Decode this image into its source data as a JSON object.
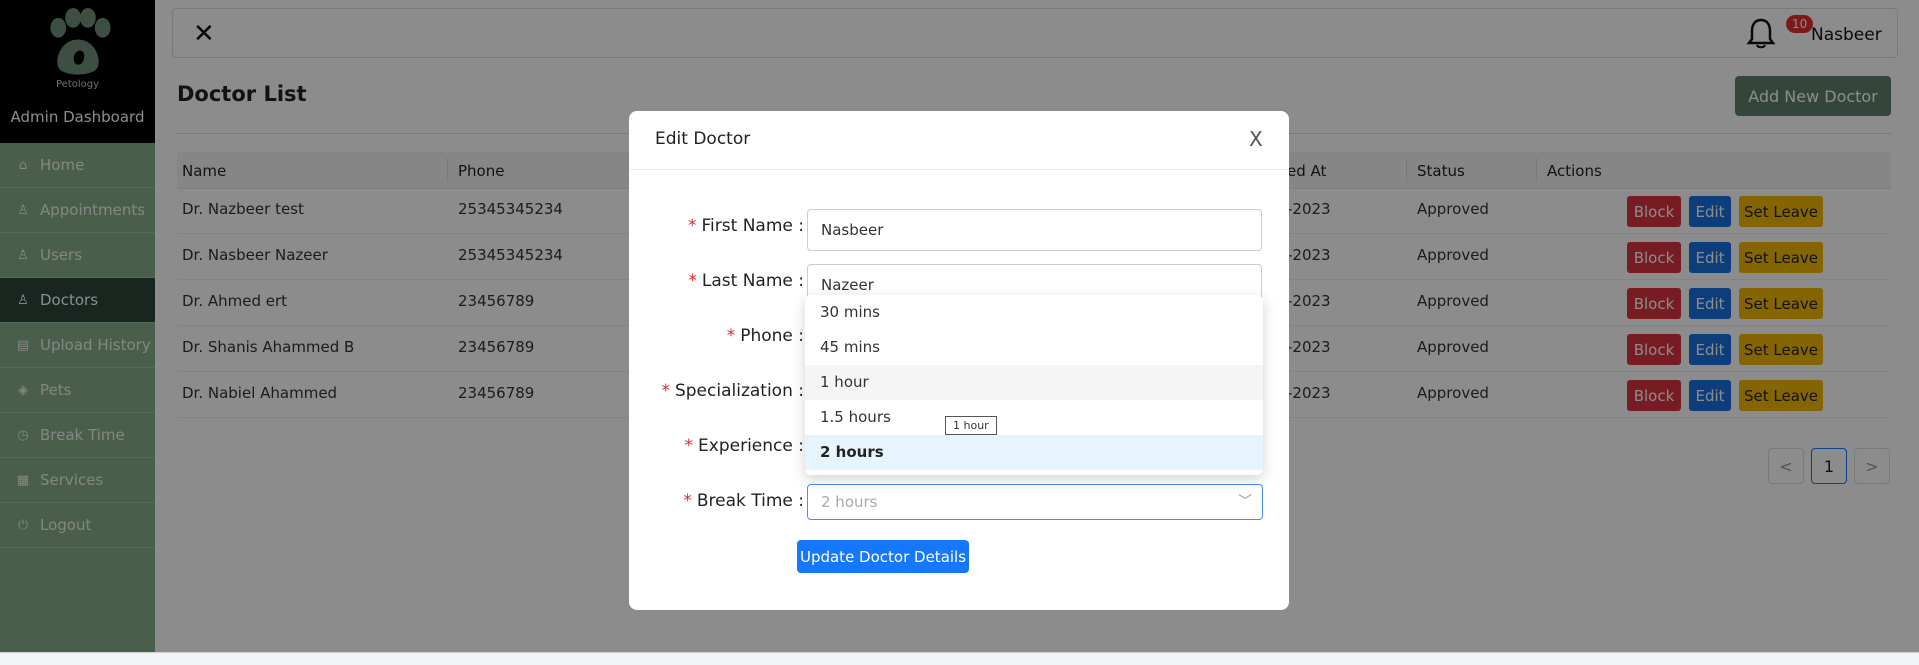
{
  "sidebar": {
    "brand": "Petology",
    "title": "Admin Dashboard",
    "items": [
      {
        "label": "Home",
        "icon": "home-icon",
        "glyph": "⌂"
      },
      {
        "label": "Appointments",
        "icon": "user-check-icon",
        "glyph": "♙"
      },
      {
        "label": "Users",
        "icon": "user-icon",
        "glyph": "♙"
      },
      {
        "label": "Doctors",
        "icon": "doctor-icon",
        "glyph": "♙"
      },
      {
        "label": "Upload History",
        "icon": "file-icon",
        "glyph": "▤"
      },
      {
        "label": "Pets",
        "icon": "shield-icon",
        "glyph": "◈"
      },
      {
        "label": "Break Time",
        "icon": "clock-icon",
        "glyph": "◷"
      },
      {
        "label": "Services",
        "icon": "list-icon",
        "glyph": "▦"
      },
      {
        "label": "Logout",
        "icon": "logout-icon",
        "glyph": "⏻"
      }
    ],
    "active_index": 3
  },
  "topbar": {
    "notification_count": "10",
    "username": "Nasbeer"
  },
  "page": {
    "title": "Doctor List",
    "add_button": "Add New Doctor"
  },
  "table": {
    "headers": [
      "Name",
      "Phone",
      "ed At",
      "Status",
      "Actions"
    ],
    "rows": [
      {
        "name": "Dr. Nazbeer test",
        "phone": "25345345234",
        "date": "-2023",
        "status": "Approved"
      },
      {
        "name": "Dr. Nasbeer Nazeer",
        "phone": "25345345234",
        "date": "-2023",
        "status": "Approved"
      },
      {
        "name": "Dr. Ahmed ert",
        "phone": "23456789",
        "date": "-2023",
        "status": "Approved"
      },
      {
        "name": "Dr. Shanis Ahammed B",
        "phone": "23456789",
        "date": "-2023",
        "status": "Approved"
      },
      {
        "name": "Dr. Nabiel Ahammed",
        "phone": "23456789",
        "date": "-2023",
        "status": "Approved"
      }
    ],
    "actions": {
      "block": "Block",
      "edit": "Edit",
      "leave": "Set Leave"
    }
  },
  "pagination": {
    "prev": "<",
    "current": "1",
    "next": ">"
  },
  "modal": {
    "title": "Edit Doctor",
    "close": "X",
    "fields": {
      "first_name": {
        "label": "First Name",
        "value": "Nasbeer"
      },
      "last_name": {
        "label": "Last Name",
        "value": "Nazeer"
      },
      "phone": {
        "label": "Phone"
      },
      "specialization": {
        "label": "Specialization"
      },
      "experience": {
        "label": "Experience"
      },
      "break_time": {
        "label": "Break Time",
        "value": "2 hours"
      }
    },
    "submit": "Update Doctor Details"
  },
  "dropdown": {
    "options": [
      "30 mins",
      "45 mins",
      "1 hour",
      "1.5 hours",
      "2 hours"
    ],
    "hover_index": 2,
    "selected_index": 4
  },
  "tooltip": "1 hour"
}
